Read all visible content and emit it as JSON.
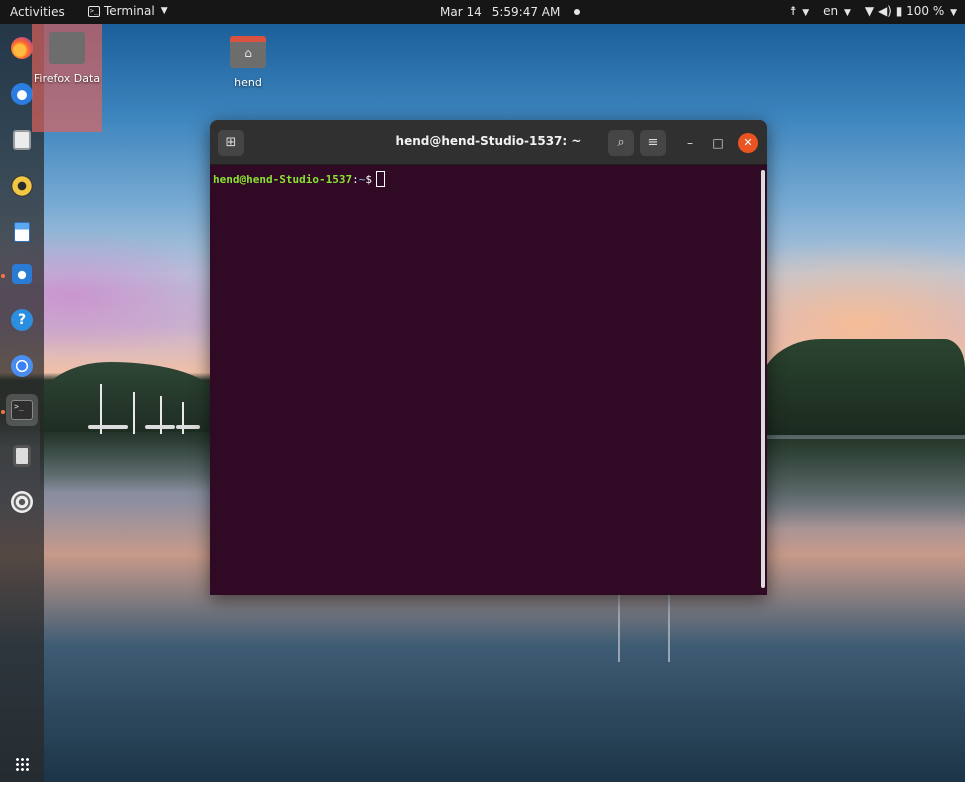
{
  "topbar": {
    "activities": "Activities",
    "app_name": "Terminal",
    "date": "Mar 14",
    "time": "5:59:47 AM",
    "language": "en",
    "battery": "100 %"
  },
  "desktop_icons": [
    {
      "label": "Firefox Data"
    },
    {
      "label": "hend"
    }
  ],
  "dock": {
    "items": [
      "firefox",
      "thunderbird",
      "files",
      "rhythmbox",
      "libreoffice-writer",
      "ubuntu-software",
      "help",
      "chromium",
      "terminal",
      "screenshot",
      "disc"
    ],
    "show_apps": "show-applications"
  },
  "terminal": {
    "title": "hend@hend-Studio-1537: ~",
    "prompt_user": "hend@hend-Studio-1537",
    "prompt_sep": ":",
    "prompt_path": "~",
    "prompt_symbol": "$"
  },
  "colors": {
    "terminal_bg": "#300a24",
    "header_bg": "#303030",
    "close_btn": "#e95420",
    "prompt_user": "#8ae234",
    "prompt_path": "#729fcf"
  }
}
